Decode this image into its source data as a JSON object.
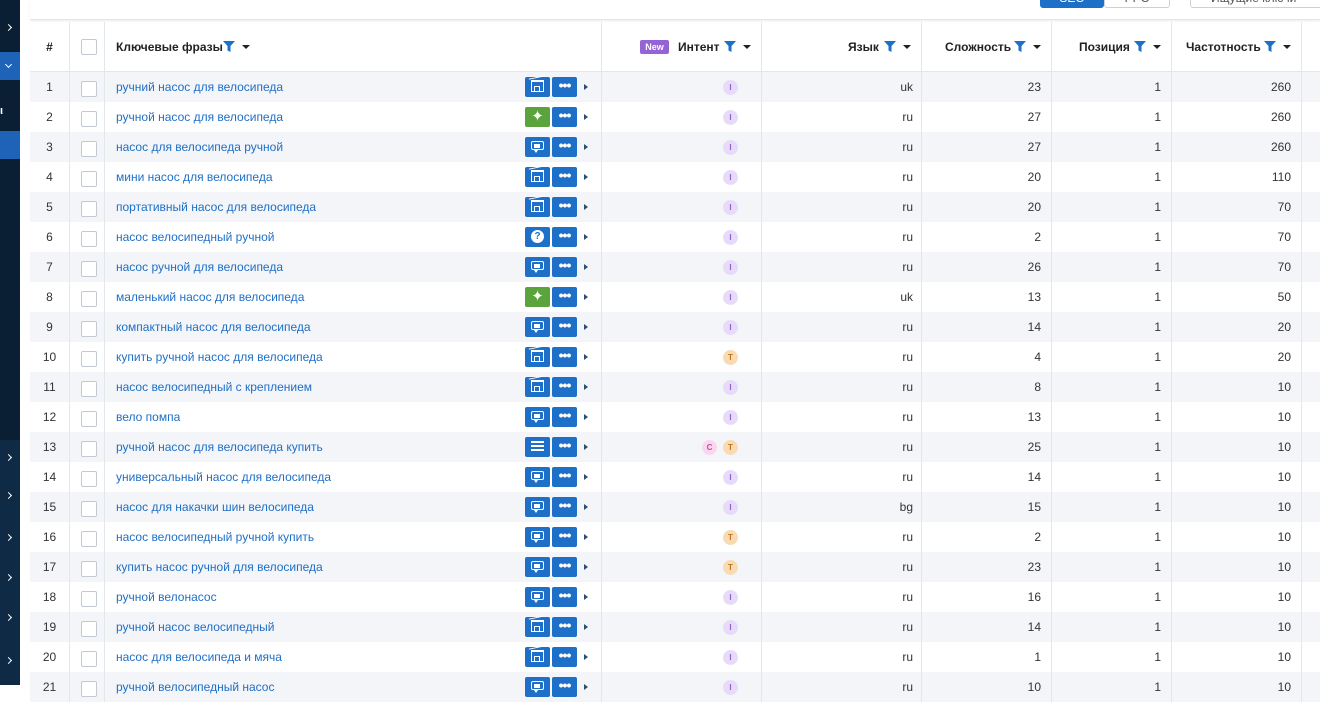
{
  "top_controls": {
    "seg_a": "SEO",
    "seg_b": "PPC",
    "button": "Ищущие ключи"
  },
  "columns": {
    "num": "#",
    "keyword": "Ключевые фразы",
    "new_badge": "New",
    "intent": "Интент",
    "language": "Язык",
    "difficulty": "Сложность",
    "position": "Позиция",
    "frequency": "Частотность"
  },
  "colors": {
    "accent": "#1e6fc7",
    "green_feature": "#5aa33d",
    "intent_i": "#e8dbfa",
    "intent_t": "#fadbb1",
    "intent_c": "#fad7ee"
  },
  "rows": [
    {
      "n": "1",
      "keyword": "ручний насос для велосипеда",
      "feature": "shopping-icon",
      "intents": [
        "I"
      ],
      "lang": "uk",
      "difficulty": "23",
      "position": "1",
      "frequency": "260"
    },
    {
      "n": "2",
      "keyword": "ручной насос для велосипеда",
      "feature": "sparkle-icon",
      "intents": [
        "I"
      ],
      "lang": "ru",
      "difficulty": "27",
      "position": "1",
      "frequency": "260"
    },
    {
      "n": "3",
      "keyword": "насос для велосипеда ручной",
      "feature": "chat-icon",
      "intents": [
        "I"
      ],
      "lang": "ru",
      "difficulty": "27",
      "position": "1",
      "frequency": "260"
    },
    {
      "n": "4",
      "keyword": "мини насос для велосипеда",
      "feature": "shopping-icon",
      "intents": [
        "I"
      ],
      "lang": "ru",
      "difficulty": "20",
      "position": "1",
      "frequency": "110"
    },
    {
      "n": "5",
      "keyword": "портативный насос для велосипеда",
      "feature": "shopping-icon",
      "intents": [
        "I"
      ],
      "lang": "ru",
      "difficulty": "20",
      "position": "1",
      "frequency": "70"
    },
    {
      "n": "6",
      "keyword": "насос велосипедный ручной",
      "feature": "question-icon",
      "intents": [
        "I"
      ],
      "lang": "ru",
      "difficulty": "2",
      "position": "1",
      "frequency": "70"
    },
    {
      "n": "7",
      "keyword": "насос ручной для велосипеда",
      "feature": "chat-icon",
      "intents": [
        "I"
      ],
      "lang": "ru",
      "difficulty": "26",
      "position": "1",
      "frequency": "70"
    },
    {
      "n": "8",
      "keyword": "маленький насос для велосипеда",
      "feature": "sparkle-icon",
      "intents": [
        "I"
      ],
      "lang": "uk",
      "difficulty": "13",
      "position": "1",
      "frequency": "50"
    },
    {
      "n": "9",
      "keyword": "компактный насос для велосипеда",
      "feature": "chat-icon",
      "intents": [
        "I"
      ],
      "lang": "ru",
      "difficulty": "14",
      "position": "1",
      "frequency": "20"
    },
    {
      "n": "10",
      "keyword": "купить ручной насос для велосипеда",
      "feature": "shopping-icon",
      "intents": [
        "T"
      ],
      "lang": "ru",
      "difficulty": "4",
      "position": "1",
      "frequency": "20"
    },
    {
      "n": "11",
      "keyword": "насос велосипедный с креплением",
      "feature": "shopping-icon",
      "intents": [
        "I"
      ],
      "lang": "ru",
      "difficulty": "8",
      "position": "1",
      "frequency": "10"
    },
    {
      "n": "12",
      "keyword": "вело помпа",
      "feature": "chat-icon",
      "intents": [
        "I"
      ],
      "lang": "ru",
      "difficulty": "13",
      "position": "1",
      "frequency": "10"
    },
    {
      "n": "13",
      "keyword": "ручной насос для велосипеда купить",
      "feature": "list-icon",
      "intents": [
        "C",
        "T"
      ],
      "lang": "ru",
      "difficulty": "25",
      "position": "1",
      "frequency": "10"
    },
    {
      "n": "14",
      "keyword": "универсальный насос для велосипеда",
      "feature": "chat-icon",
      "intents": [
        "I"
      ],
      "lang": "ru",
      "difficulty": "14",
      "position": "1",
      "frequency": "10"
    },
    {
      "n": "15",
      "keyword": "насос для накачки шин велосипеда",
      "feature": "chat-icon",
      "intents": [
        "I"
      ],
      "lang": "bg",
      "difficulty": "15",
      "position": "1",
      "frequency": "10"
    },
    {
      "n": "16",
      "keyword": "насос велосипедный ручной купить",
      "feature": "chat-icon",
      "intents": [
        "T"
      ],
      "lang": "ru",
      "difficulty": "2",
      "position": "1",
      "frequency": "10"
    },
    {
      "n": "17",
      "keyword": "купить насос ручной для велосипеда",
      "feature": "chat-icon",
      "intents": [
        "T"
      ],
      "lang": "ru",
      "difficulty": "23",
      "position": "1",
      "frequency": "10"
    },
    {
      "n": "18",
      "keyword": "ручной велонасос",
      "feature": "chat-icon",
      "intents": [
        "I"
      ],
      "lang": "ru",
      "difficulty": "16",
      "position": "1",
      "frequency": "10"
    },
    {
      "n": "19",
      "keyword": "ручной насос велосипедный",
      "feature": "shopping-icon",
      "intents": [
        "I"
      ],
      "lang": "ru",
      "difficulty": "14",
      "position": "1",
      "frequency": "10"
    },
    {
      "n": "20",
      "keyword": "насос для велосипеда и мяча",
      "feature": "shopping-icon",
      "intents": [
        "I"
      ],
      "lang": "ru",
      "difficulty": "1",
      "position": "1",
      "frequency": "10"
    },
    {
      "n": "21",
      "keyword": "ручной велосипедный насос",
      "feature": "chat-icon",
      "intents": [
        "I"
      ],
      "lang": "ru",
      "difficulty": "10",
      "position": "1",
      "frequency": "10"
    }
  ]
}
